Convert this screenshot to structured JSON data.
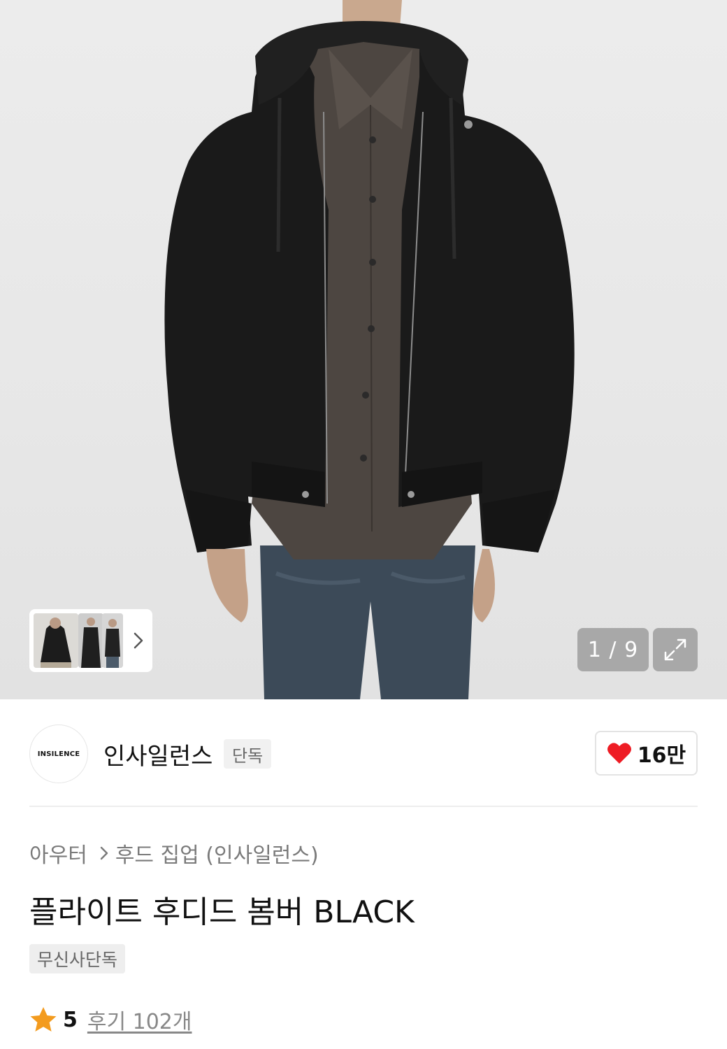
{
  "gallery": {
    "counter_text": "1 / 9",
    "icons": {
      "next": "chevron-right-icon",
      "expand": "expand-arrows-icon"
    }
  },
  "brand": {
    "logo_text": "INSILENCE",
    "name": "인사일런스",
    "badge": "단독",
    "like_count": "16만",
    "like_icon": "heart-icon",
    "like_color": "#ee1c24"
  },
  "breadcrumb": {
    "items": [
      "아우터",
      "후드 집업 (인사일런스)"
    ]
  },
  "product": {
    "title": "플라이트 후디드 봄버 BLACK",
    "tag": "무신사단독"
  },
  "rating": {
    "score": "5",
    "review_text": "후기 102개",
    "star_color": "#f39b1e"
  }
}
